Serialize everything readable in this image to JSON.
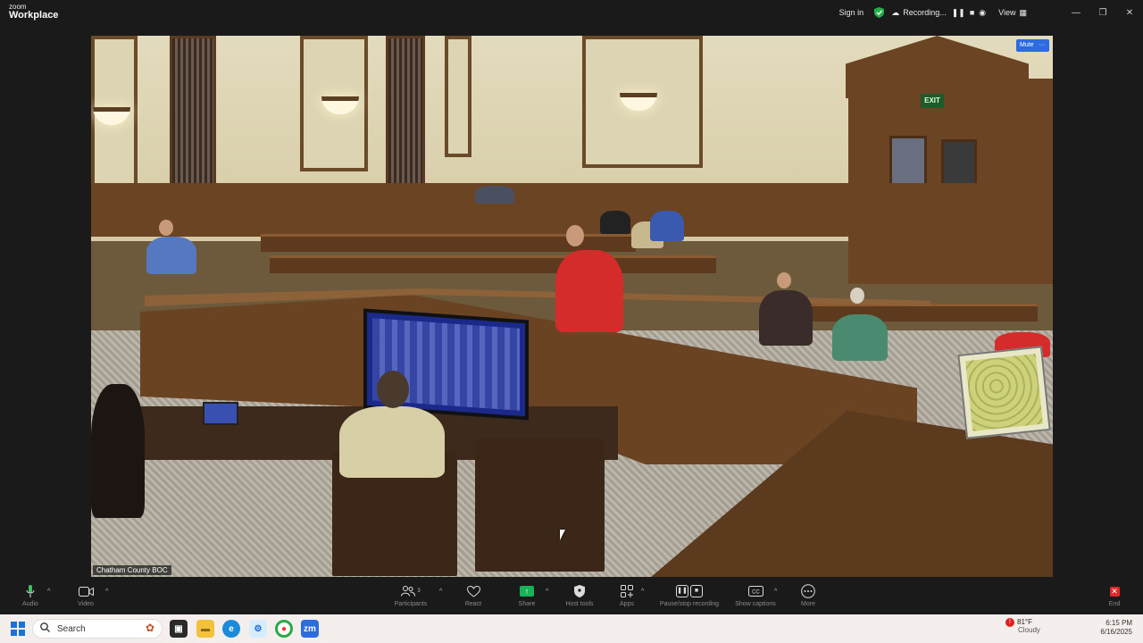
{
  "app": {
    "brand_line1": "zoom",
    "brand_line2": "Workplace"
  },
  "titlebar": {
    "sign_in": "Sign in",
    "recording": "Recording...",
    "view": "View",
    "minimize": "—",
    "restore": "❐",
    "close": "✕"
  },
  "video": {
    "mute_label": "Mute",
    "more_label": "···",
    "participant_name": "Chatham County BOC",
    "exit_sign": "EXIT"
  },
  "toolbar": {
    "audio": "Audio",
    "video": "Video",
    "participants": "Participants",
    "participants_count": "3",
    "react": "React",
    "share": "Share",
    "host_tools": "Host tools",
    "apps": "Apps",
    "pause_stop_recording": "Pause/stop recording",
    "show_captions": "Show captions",
    "more": "More",
    "end": "End"
  },
  "taskbar": {
    "search_placeholder": "Search",
    "weather_temp": "81°F",
    "weather_desc": "Cloudy",
    "time": "6:15 PM",
    "date": "6/16/2025"
  },
  "colors": {
    "mute_blue": "#2d6ce0",
    "share_green": "#17b35a",
    "end_red": "#e02828",
    "shield_green": "#22b04a"
  }
}
